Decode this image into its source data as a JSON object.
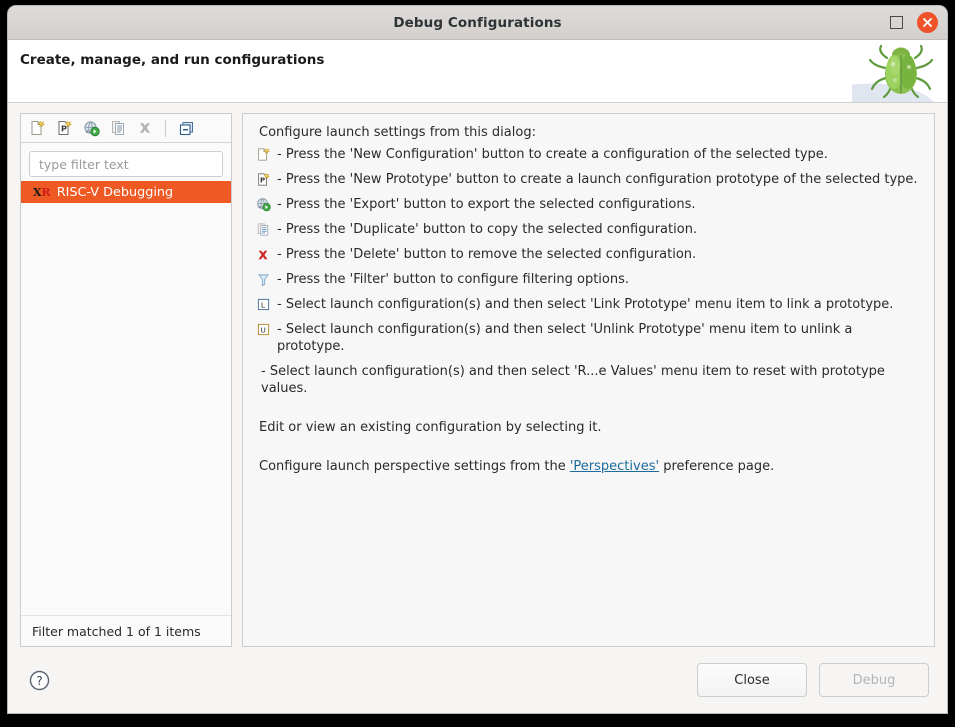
{
  "window": {
    "title": "Debug Configurations",
    "maximize_icon": "maximize-icon",
    "close_icon": "close-icon"
  },
  "header": {
    "title": "Create, manage, and run configurations",
    "logo_icon": "bug-icon"
  },
  "toolbar": {
    "buttons": [
      {
        "name": "new-configuration-button",
        "icon": "new-configuration-icon",
        "enabled": true
      },
      {
        "name": "new-prototype-button",
        "icon": "new-prototype-icon",
        "enabled": true
      },
      {
        "name": "export-button",
        "icon": "export-icon",
        "enabled": true
      },
      {
        "name": "duplicate-button",
        "icon": "duplicate-icon",
        "enabled": false
      },
      {
        "name": "delete-button",
        "icon": "delete-icon",
        "enabled": false
      },
      {
        "name": "collapse-all-button",
        "icon": "collapse-all-icon",
        "enabled": true
      }
    ]
  },
  "filter": {
    "placeholder": "type filter text",
    "value": ""
  },
  "tree": {
    "items": [
      {
        "label": "RISC-V Debugging",
        "icon_text_1": "X",
        "icon_text_2": "R",
        "selected": true
      }
    ],
    "status": "Filter matched 1 of 1 items",
    "selection_color": "#ef5a24"
  },
  "main": {
    "intro": "Configure launch settings from this dialog:",
    "hints": [
      {
        "icon": "new-configuration-icon",
        "text": "- Press the 'New Configuration' button to create a configuration of the selected type."
      },
      {
        "icon": "new-prototype-icon",
        "text": "- Press the 'New Prototype' button to create a launch configuration prototype of the selected type."
      },
      {
        "icon": "export-icon",
        "text": "- Press the 'Export' button to export the selected configurations."
      },
      {
        "icon": "duplicate-icon",
        "text": "- Press the 'Duplicate' button to copy the selected configuration."
      },
      {
        "icon": "delete-icon",
        "text": "- Press the 'Delete' button to remove the selected configuration."
      },
      {
        "icon": "filter-icon",
        "text": "- Press the 'Filter' button to configure filtering options."
      },
      {
        "icon": "link-prototype-icon",
        "text": "- Select launch configuration(s) and then select 'Link Prototype' menu item to link a prototype."
      },
      {
        "icon": "unlink-prototype-icon",
        "text": "- Select launch configuration(s) and then select 'Unlink Prototype' menu item to unlink a prototype."
      },
      {
        "icon": "none",
        "text": "- Select launch configuration(s) and then select 'R...e Values' menu item to reset with prototype values."
      }
    ],
    "edit_note": "Edit or view an existing configuration by selecting it.",
    "perspective_prefix": "Configure launch perspective settings from the ",
    "perspective_link": "'Perspectives'",
    "perspective_suffix": " preference page."
  },
  "footer": {
    "help_icon": "help-icon",
    "close_label": "Close",
    "debug_label": "Debug",
    "debug_enabled": false
  }
}
